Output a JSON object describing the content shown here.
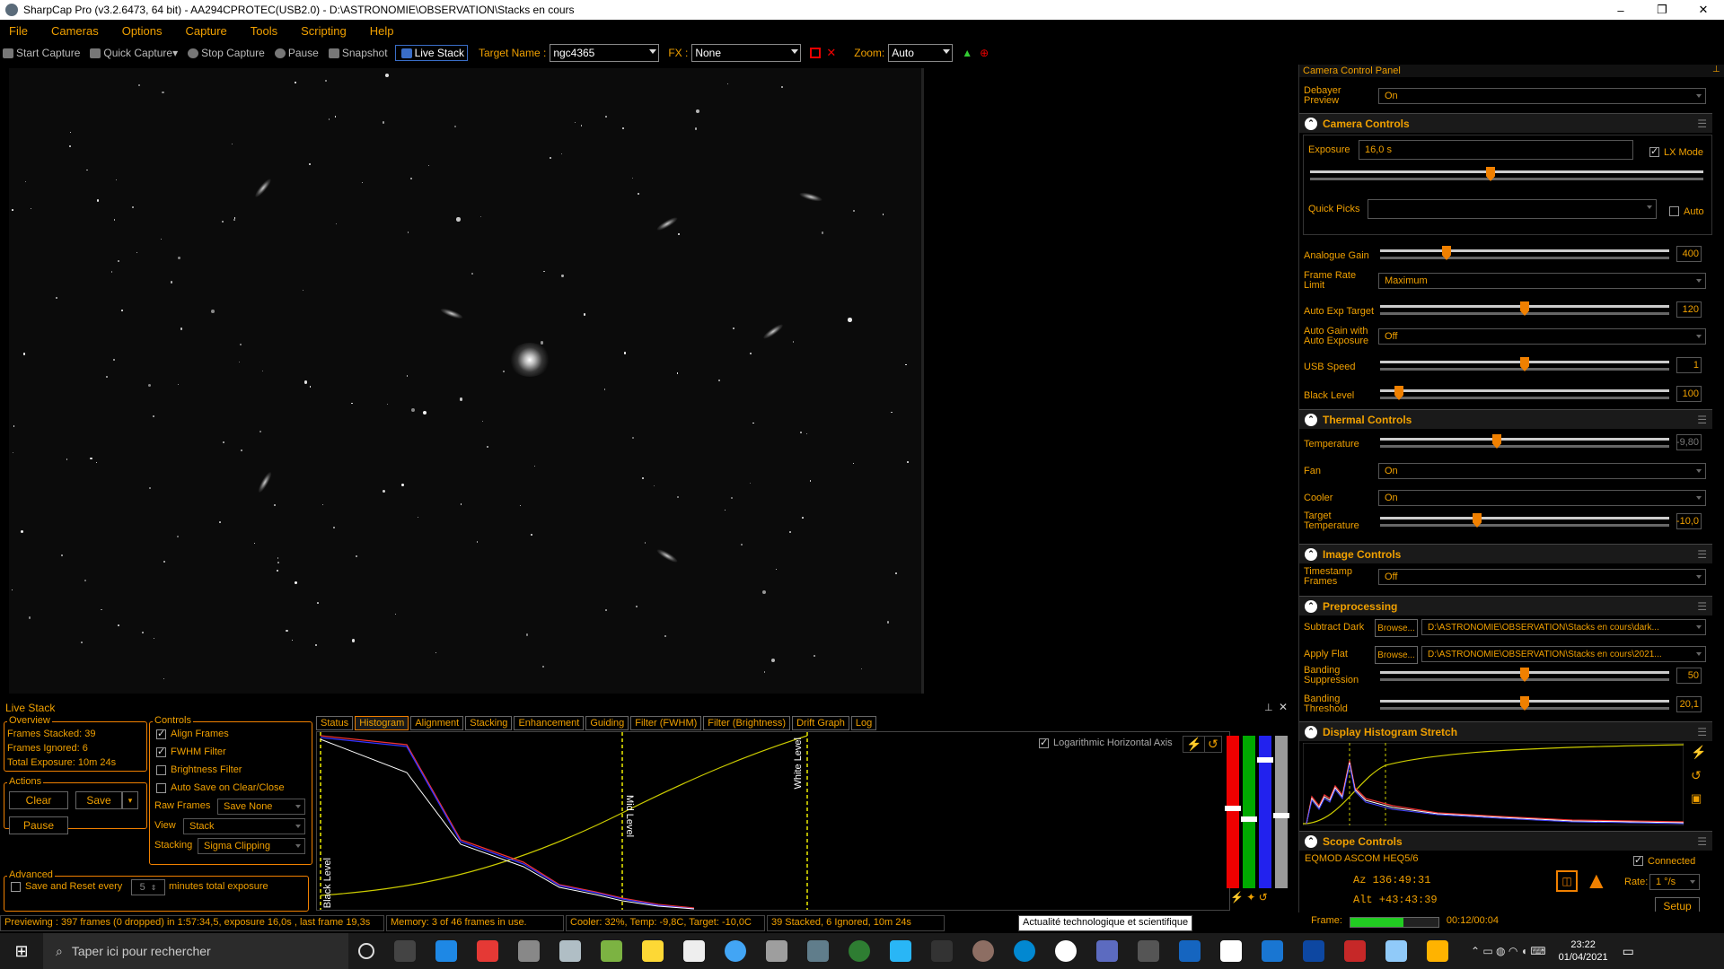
{
  "window": {
    "title": "SharpCap Pro (v3.2.6473, 64 bit) - AA294CPROTEC(USB2.0) - D:\\ASTRONOMIE\\OBSERVATION\\Stacks en cours",
    "minimize": "–",
    "maximize": "❐",
    "close": "✕"
  },
  "menu": [
    "File",
    "Cameras",
    "Options",
    "Capture",
    "Tools",
    "Scripting",
    "Help"
  ],
  "toolbar": {
    "start_capture": "Start Capture",
    "quick_capture": "Quick Capture",
    "stop_capture": "Stop Capture",
    "pause": "Pause",
    "snapshot": "Snapshot",
    "live_stack": "Live Stack",
    "target_label": "Target Name :",
    "target_value": "ngc4365",
    "fx_label": "FX :",
    "fx_value": "None",
    "zoom_label": "Zoom:",
    "zoom_value": "Auto"
  },
  "right_panel": {
    "header": "Camera Control Panel",
    "debayer": {
      "label": "Debayer Preview",
      "value": "On"
    },
    "camera_controls": {
      "title": "Camera Controls",
      "exposure_label": "Exposure",
      "exposure_value": "16,0 s",
      "lx_mode": "LX Mode",
      "quick_picks": "Quick Picks",
      "auto": "Auto",
      "analogue_gain": {
        "label": "Analogue Gain",
        "value": "400",
        "level": 0.22
      },
      "frame_rate": {
        "label": "Frame Rate Limit",
        "value": "Maximum"
      },
      "auto_exp_target": {
        "label": "Auto Exp Target",
        "value": "120",
        "level": 0.5
      },
      "auto_gain": {
        "label": "Auto Gain with Auto Exposure",
        "value": "Off"
      },
      "usb_speed": {
        "label": "USB Speed",
        "value": "1",
        "level": 0.5
      },
      "black_level": {
        "label": "Black Level",
        "value": "100",
        "level": 0.05
      }
    },
    "thermal": {
      "title": "Thermal Controls",
      "temperature": {
        "label": "Temperature",
        "value": "-9,80",
        "level": 0.4
      },
      "fan": {
        "label": "Fan",
        "value": "On"
      },
      "cooler": {
        "label": "Cooler",
        "value": "On"
      },
      "target_temp": {
        "label": "Target Temperature",
        "value": "-10,0",
        "level": 0.33
      }
    },
    "image_controls": {
      "title": "Image Controls",
      "timestamp": {
        "label": "Timestamp Frames",
        "value": "Off"
      }
    },
    "preprocessing": {
      "title": "Preprocessing",
      "subtract_dark": "Subtract Dark",
      "apply_flat": "Apply Flat",
      "browse": "Browse...",
      "dark_path": "D:\\ASTRONOMIE\\OBSERVATION\\Stacks en cours\\dark...",
      "flat_path": "D:\\ASTRONOMIE\\OBSERVATION\\Stacks en cours\\2021...",
      "banding_supp": {
        "label": "Banding Suppression",
        "value": "50",
        "level": 0.5
      },
      "banding_thr": {
        "label": "Banding Threshold",
        "value": "20,1",
        "level": 0.5
      }
    },
    "histogram_stretch": {
      "title": "Display Histogram Stretch"
    },
    "scope": {
      "title": "Scope Controls",
      "mount": "EQMOD ASCOM HEQ5/6",
      "connected": "Connected",
      "az": "Az  136:49:31",
      "alt": "Alt  +43:43:39",
      "rate_label": "Rate:",
      "rate_value": "1 °/s",
      "setup": "Setup",
      "stop": "STOP"
    },
    "frame_label": "Frame:",
    "frame_time": "00:12/00:04"
  },
  "live_stack": {
    "title": "Live Stack",
    "overview": {
      "label": "Overview",
      "frames_stacked": "Frames Stacked:  39",
      "frames_ignored": "Frames Ignored:  6",
      "total_exposure": "Total Exposure:   10m 24s"
    },
    "actions": {
      "label": "Actions",
      "clear": "Clear",
      "save": "Save",
      "pause": "Pause"
    },
    "advanced": {
      "label": "Advanced",
      "save_reset": "Save and Reset every",
      "minutes_value": "5",
      "minutes_text": "minutes total exposure"
    },
    "controls": {
      "label": "Controls",
      "align": "Align Frames",
      "fwhm": "FWHM Filter",
      "brightness": "Brightness Filter",
      "autosave": "Auto Save on Clear/Close",
      "raw_frames_label": "Raw Frames",
      "raw_frames_value": "Save None",
      "view_label": "View",
      "view_value": "Stack",
      "stacking_label": "Stacking",
      "stacking_value": "Sigma Clipping"
    },
    "tabs": [
      "Status",
      "Histogram",
      "Alignment",
      "Stacking",
      "Enhancement",
      "Guiding",
      "Filter (FWHM)",
      "Filter (Brightness)",
      "Drift Graph",
      "Log"
    ],
    "histogram": {
      "log_axis": "Logarithmic Horizontal Axis",
      "black_level": "Black Level",
      "mid_level": "Mid Level",
      "white_level": "White Level"
    }
  },
  "status": {
    "preview": "Previewing : 397 frames (0 dropped) in 1:57:34,5, exposure 16,0s , last frame 19,3s",
    "memory": "Memory: 3 of 46 frames in use.",
    "cooler": "Cooler: 32%, Temp: -9,8C, Target: -10,0C",
    "stacked": "39 Stacked, 6 Ignored, 10m 24s",
    "tooltip": "Actualité technologique et scientifique"
  },
  "taskbar": {
    "search": "Taper ici pour rechercher",
    "time": "23:22",
    "date": "01/04/2021"
  },
  "colors": {
    "accent": "#f0a000",
    "slider_thumb": "#f08000"
  }
}
